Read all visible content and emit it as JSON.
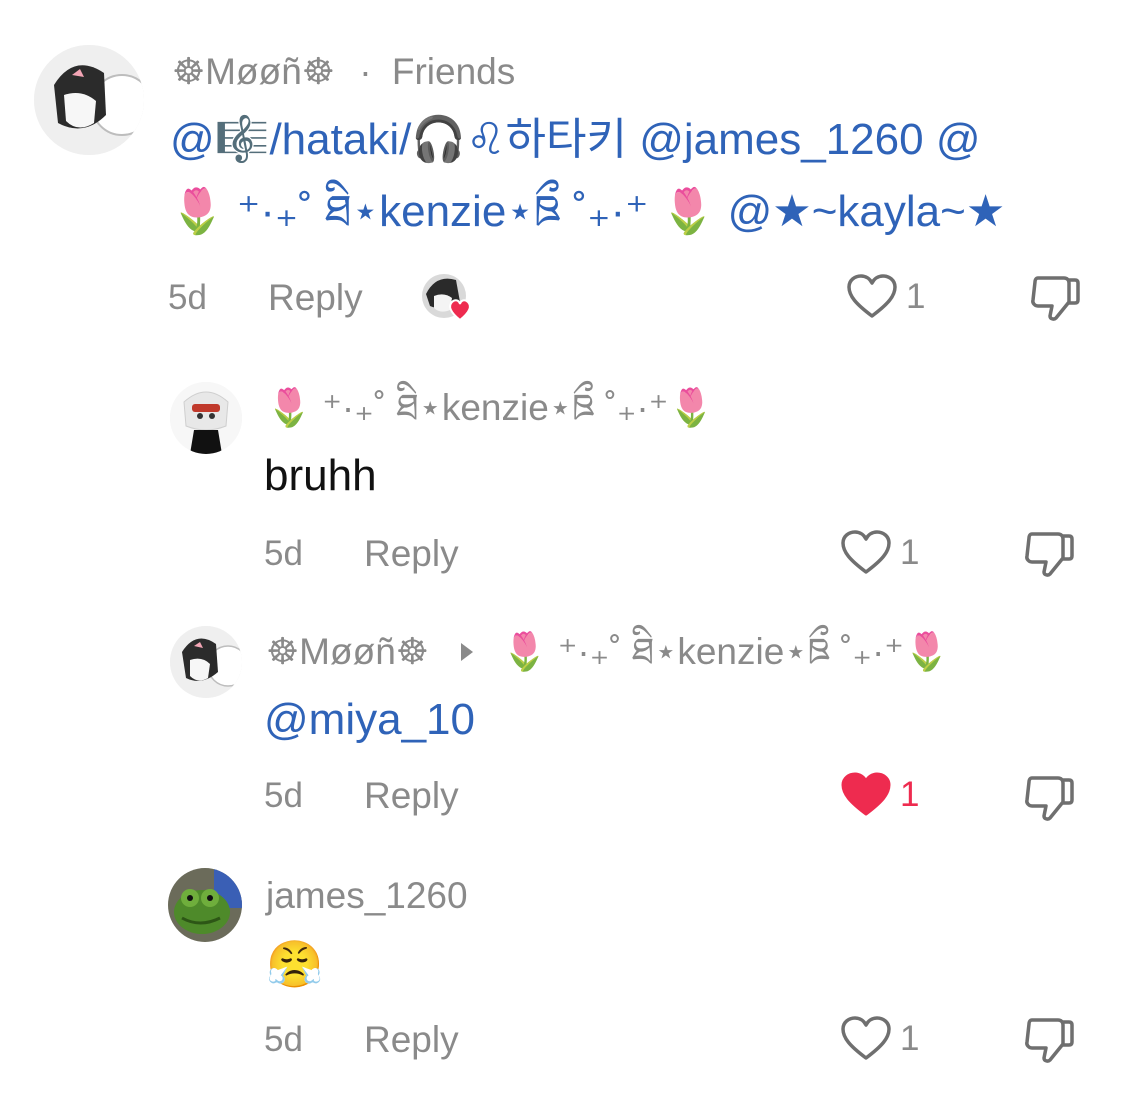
{
  "comments": [
    {
      "username": "☸Møøñ☸",
      "relation": "Friends",
      "separator": "·",
      "text_line1": "@🎼/hataki/🎧♌하타키 @james_1260 @",
      "text_line2": "🌷 ⁺·₊˚ ཐི⋆kenzie⋆ཋྀ ˚₊·⁺ 🌷  @★~kayla~★",
      "time": "5d",
      "reply_label": "Reply",
      "likes": "1",
      "creator_liked": true
    },
    {
      "username": "🌷 ⁺·₊˚ ཐི⋆kenzie⋆ཋྀ ˚₊·⁺🌷",
      "text": "bruhh",
      "time": "5d",
      "reply_label": "Reply",
      "likes": "1"
    },
    {
      "username": "☸Møøñ☸",
      "reply_to": "🌷 ⁺·₊˚ ཐི⋆kenzie⋆ཋྀ ˚₊·⁺🌷",
      "text": "@miya_10",
      "time": "5d",
      "reply_label": "Reply",
      "likes": "1",
      "liked": true
    },
    {
      "username": "james_1260",
      "text": "😤",
      "time": "5d",
      "reply_label": "Reply",
      "likes": "1"
    }
  ],
  "colors": {
    "mention": "#2f63b8",
    "muted": "#8a8a8a",
    "liked": "#ee2b4f"
  },
  "icons": [
    "heart-icon",
    "heart-filled-icon",
    "dislike-icon",
    "creator-liked-badge"
  ]
}
